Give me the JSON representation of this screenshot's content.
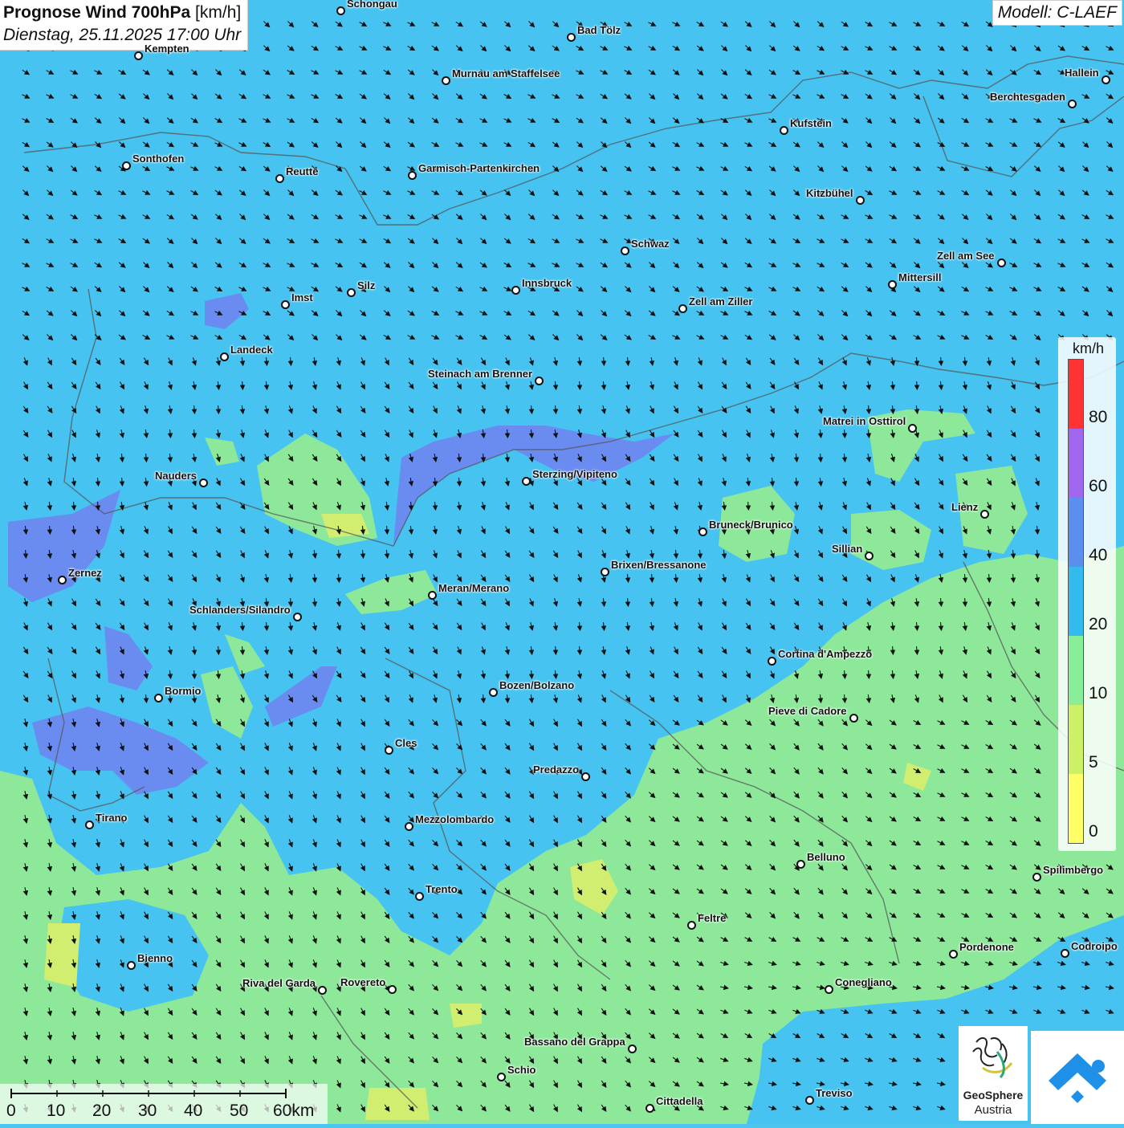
{
  "header": {
    "title_bold": "Prognose Wind 700hPa",
    "title_unit": "[km/h]",
    "datetime": "Dienstag, 25.11.2025 17:00 Uhr",
    "model": "Modell: C-LAEF"
  },
  "legend": {
    "unit": "km/h",
    "ticks": [
      "80",
      "60",
      "40",
      "20",
      "10",
      "5",
      "0"
    ],
    "colors": [
      "#ff3333",
      "#a066ee",
      "#5a8ff0",
      "#33bbee",
      "#88ee99",
      "#ccf066",
      "#ffff66"
    ]
  },
  "scale_bar": {
    "labels": [
      "0",
      "10",
      "20",
      "30",
      "40",
      "50",
      "60km"
    ]
  },
  "logos": {
    "geosphere_line1": "GeoSphere",
    "geosphere_line2": "Austria"
  },
  "colors": {
    "wind_20_40": "#44c4f2",
    "wind_10_20": "#8ee89a",
    "wind_5_10": "#d2ee70",
    "wind_40_60": "#6a8cf0"
  },
  "cities": [
    "Schongau",
    "Bad Tölz",
    "Kempten",
    "Murnau am Staffelsee",
    "Hallein",
    "Berchtesgaden",
    "Kufstein",
    "Sonthofen",
    "Reutte",
    "Garmisch-Partenkirchen",
    "Kitzbühel",
    "Schwaz",
    "Zell am See",
    "Mittersill",
    "Innsbruck",
    "Silz",
    "Imst",
    "Zell am Ziller",
    "Landeck",
    "Steinach am Brenner",
    "Matrei in Osttirol",
    "Nauders",
    "Sterzing/Vipiteno",
    "Lienz",
    "Bruneck/Brunico",
    "Sillian",
    "Brixen/Bressanone",
    "Zernez",
    "Meran/Merano",
    "Schlanders/Silandro",
    "Cortina d'Ampezzo",
    "Bozen/Bolzano",
    "Bormio",
    "Pieve di Cadore",
    "Cles",
    "Predazzo",
    "Tirano",
    "Mezzolombardo",
    "Belluno",
    "Spilimbergo",
    "Trento",
    "Feltre",
    "Pordenone",
    "Codroipo",
    "Bienno",
    "Riva del Garda",
    "Rovereto",
    "Conegliano",
    "Bassano del Grappa",
    "Schio",
    "Treviso",
    "Cittadella"
  ]
}
